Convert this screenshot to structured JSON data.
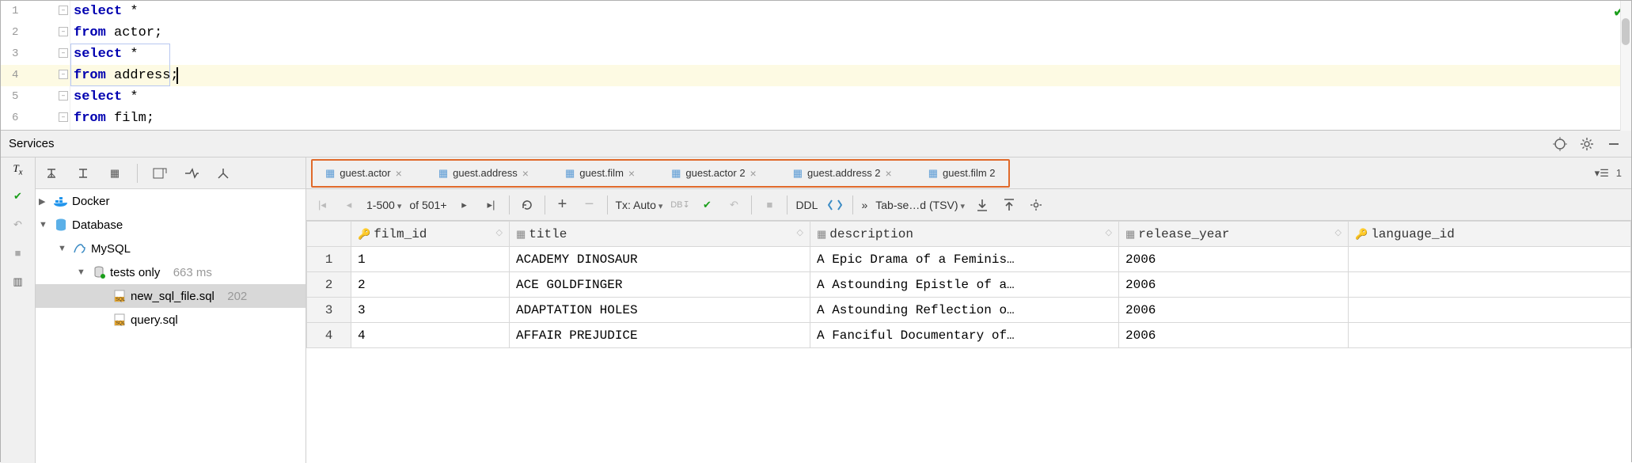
{
  "editor": {
    "lines": [
      {
        "n": "1",
        "kw": "select",
        "rest": " *"
      },
      {
        "n": "2",
        "kw": "from",
        "rest": " actor;"
      },
      {
        "n": "3",
        "kw": "select",
        "rest": " *"
      },
      {
        "n": "4",
        "kw": "from",
        "rest": " address;"
      },
      {
        "n": "5",
        "kw": "select",
        "rest": " *"
      },
      {
        "n": "6",
        "kw": "from",
        "rest": " film;"
      }
    ]
  },
  "services_label": "Services",
  "tree": {
    "docker": "Docker",
    "database": "Database",
    "mysql": "MySQL",
    "tests": "tests only",
    "tests_time": "663 ms",
    "file1": "new_sql_file.sql",
    "file1_meta": "202",
    "file2": "query.sql"
  },
  "tabs": [
    "guest.actor",
    "guest.address",
    "guest.film",
    "guest.actor 2",
    "guest.address 2",
    "guest.film 2"
  ],
  "tab_counter": "1",
  "toolbar": {
    "page_range": "1-500",
    "page_of": "of 501+",
    "tx_label": "Tx: Auto",
    "ddl_label": "DDL",
    "export_label": "Tab-se…d (TSV)",
    "more": "»"
  },
  "columns": [
    "film_id",
    "title",
    "description",
    "release_year",
    "language_id"
  ],
  "rows": [
    {
      "n": "1",
      "id": "1",
      "title": "ACADEMY DINOSAUR",
      "desc": "A Epic Drama of a Feminis…",
      "year": "2006"
    },
    {
      "n": "2",
      "id": "2",
      "title": "ACE GOLDFINGER",
      "desc": "A Astounding Epistle of a…",
      "year": "2006"
    },
    {
      "n": "3",
      "id": "3",
      "title": "ADAPTATION HOLES",
      "desc": "A Astounding Reflection o…",
      "year": "2006"
    },
    {
      "n": "4",
      "id": "4",
      "title": "AFFAIR PREJUDICE",
      "desc": "A Fanciful Documentary of…",
      "year": "2006"
    }
  ]
}
